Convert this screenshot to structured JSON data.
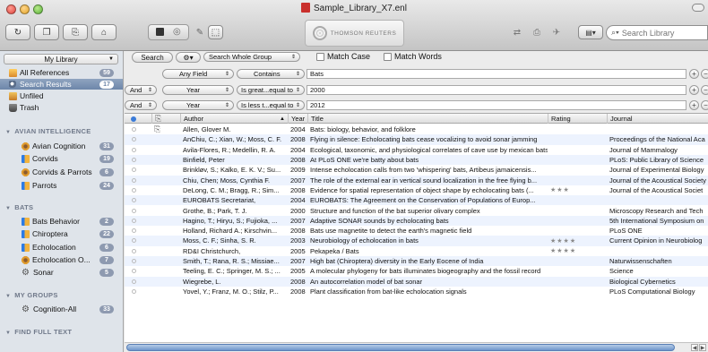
{
  "window": {
    "title": "Sample_Library_X7.enl"
  },
  "toolbar": {
    "brand": "THOMSON REUTERS",
    "search_placeholder": "Search Library"
  },
  "sidebar": {
    "library_dropdown": "My Library",
    "top_items": [
      {
        "label": "All References",
        "count": "59",
        "icon": "library-icon"
      },
      {
        "label": "Search Results",
        "count": "17",
        "icon": "search-results-icon"
      },
      {
        "label": "Unfiled",
        "count": "",
        "icon": "unfiled-icon"
      },
      {
        "label": "Trash",
        "count": "",
        "icon": "trash-icon"
      }
    ],
    "sections": [
      {
        "label": "AVIAN INTELLIGENCE",
        "items": [
          {
            "label": "Avian Cognition",
            "count": "31",
            "icon": "smart-group-icon"
          },
          {
            "label": "Corvids",
            "count": "19",
            "icon": "group-icon"
          },
          {
            "label": "Corvids & Parrots",
            "count": "6",
            "icon": "smart-group-icon"
          },
          {
            "label": "Parrots",
            "count": "24",
            "icon": "group-icon"
          }
        ]
      },
      {
        "label": "BATS",
        "items": [
          {
            "label": "Bats Behavior",
            "count": "2",
            "icon": "group-icon"
          },
          {
            "label": "Chiroptera",
            "count": "22",
            "icon": "group-icon"
          },
          {
            "label": "Echolocation",
            "count": "6",
            "icon": "group-icon"
          },
          {
            "label": "Echolocation O...",
            "count": "7",
            "icon": "smart-group-icon"
          },
          {
            "label": "Sonar",
            "count": "5",
            "icon": "gear-icon"
          }
        ]
      },
      {
        "label": "MY GROUPS",
        "items": [
          {
            "label": "Cognition-All",
            "count": "33",
            "icon": "gear-icon"
          }
        ]
      },
      {
        "label": "FIND FULL TEXT",
        "items": []
      }
    ]
  },
  "search": {
    "search_button": "Search",
    "scope": "Search Whole Group",
    "match_case": "Match Case",
    "match_words": "Match Words",
    "rows": [
      {
        "bool": "",
        "field": "Any Field",
        "op": "Contains",
        "value": "Bats"
      },
      {
        "bool": "And",
        "field": "Year",
        "op": "Is great...equal to",
        "value": "2000"
      },
      {
        "bool": "And",
        "field": "Year",
        "op": "Is less t...equal to",
        "value": "2012"
      }
    ]
  },
  "table": {
    "headers": {
      "author": "Author",
      "year": "Year",
      "title": "Title",
      "rating": "Rating",
      "journal": "Journal"
    },
    "rows": [
      {
        "author": "Allen, Glover M.",
        "year": "2004",
        "title": "Bats: biology, behavior, and folklore",
        "rating": "",
        "journal": "",
        "attach": true
      },
      {
        "author": "AnChiu, C.; Xian, W.; Moss, C. F.",
        "year": "2008",
        "title": "Flying in silence: Echolocating bats cease vocalizing to avoid sonar jamming",
        "rating": "",
        "journal": "Proceedings of the National Aca",
        "attach": false
      },
      {
        "author": "Avila-Flores, R.; Medellin, R. A.",
        "year": "2004",
        "title": "Ecological, taxonomic, and physiological correlates of cave use by mexican bats",
        "rating": "",
        "journal": "Journal of Mammalogy",
        "attach": false
      },
      {
        "author": "Binfield, Peter",
        "year": "2008",
        "title": "At PLoS ONE we're batty about bats",
        "rating": "",
        "journal": "PLoS: Public Library of Science",
        "attach": false
      },
      {
        "author": "Brinkløv, S.; Kalko, E. K. V.; Su...",
        "year": "2009",
        "title": "Intense echolocation calls from two 'whispering' bats, Artibeus jamaicensis...",
        "rating": "",
        "journal": "Journal of Experimental Biology",
        "attach": false
      },
      {
        "author": "Chiu, Chen; Moss, Cynthia F.",
        "year": "2007",
        "title": "The role of the external ear in vertical sound localization in the free flying b...",
        "rating": "",
        "journal": "Journal of the Acoustical Society",
        "attach": false
      },
      {
        "author": "DeLong, C. M.; Bragg, R.; Sim...",
        "year": "2008",
        "title": "Evidence for spatial representation of object shape by echolocating bats (...",
        "rating": "★★★",
        "journal": "Journal of the Acoustical Societ",
        "attach": false
      },
      {
        "author": "EUROBATS Secretariat,",
        "year": "2004",
        "title": "EUROBATS: The Agreement on the Conservation of Populations of Europ...",
        "rating": "",
        "journal": "",
        "attach": false
      },
      {
        "author": "Grothe, B.; Park, T. J.",
        "year": "2000",
        "title": "Structure and function of the bat superior olivary complex",
        "rating": "",
        "journal": "Microscopy Research and Tech",
        "attach": false
      },
      {
        "author": "Hagino, T.; Hiryu, S.; Fujioka, ...",
        "year": "2007",
        "title": "Adaptive SONAR sounds by echolocating bats",
        "rating": "",
        "journal": "5th International Symposium on",
        "attach": false
      },
      {
        "author": "Holland, Richard A.; Kirschvin...",
        "year": "2008",
        "title": "Bats use magnetite to detect the earth's magnetic field",
        "rating": "",
        "journal": "PLoS ONE",
        "attach": false
      },
      {
        "author": "Moss, C. F.; Sinha, S. R.",
        "year": "2003",
        "title": "Neurobiology of echolocation in bats",
        "rating": "★★★★",
        "journal": "Current Opinion in Neurobiolog",
        "attach": false
      },
      {
        "author": "RD&I Christchurch,",
        "year": "2005",
        "title": "Pekapeka / Bats",
        "rating": "★★★★",
        "journal": "",
        "attach": false
      },
      {
        "author": "Smith, T.; Rana, R. S.; Missiae...",
        "year": "2007",
        "title": "High bat (Chiroptera) diversity in the Early Eocene of India",
        "rating": "",
        "journal": "Naturwissenschaften",
        "attach": false
      },
      {
        "author": "Teeling, E. C.; Springer, M. S.; ...",
        "year": "2005",
        "title": "A molecular phylogeny for bats illuminates biogeography and the fossil record",
        "rating": "",
        "journal": "Science",
        "attach": false
      },
      {
        "author": "Wiegrebe, L.",
        "year": "2008",
        "title": "An autocorrelation model of bat sonar",
        "rating": "",
        "journal": "Biological Cybernetics",
        "attach": false
      },
      {
        "author": "Yovel, Y.; Franz, M. O.; Stilz, P...",
        "year": "2008",
        "title": "Plant classification from bat-like echolocation signals",
        "rating": "",
        "journal": "PLoS Computational Biology",
        "attach": false
      }
    ]
  }
}
